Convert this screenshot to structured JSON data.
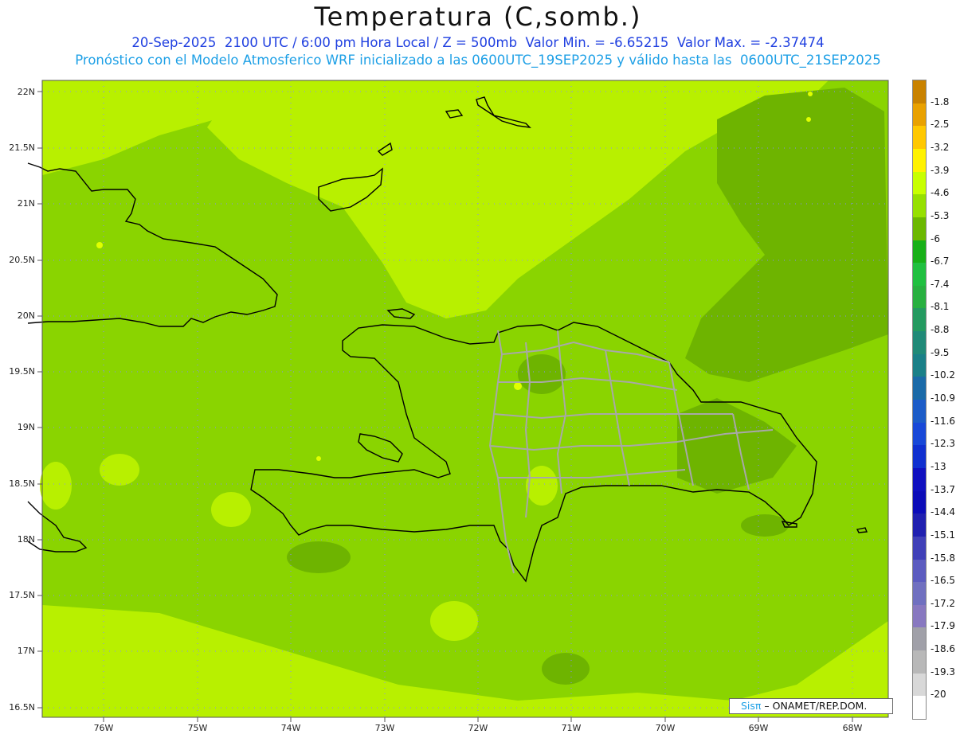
{
  "header": {
    "title": "Temperatura (C,somb.)",
    "subtitle_1": "20-Sep-2025  2100 UTC / 6:00 pm Hora Local / Z = 500mb  Valor Min. = -6.65215  Valor Max. = -2.37474",
    "subtitle_2": "Pronóstico con el Modelo Atmosferico WRF inicializado a las 0600UTC_19SEP2025 y válido hasta las  0600UTC_21SEP2025"
  },
  "axes": {
    "lat_labels": [
      "22N",
      "21.5N",
      "21N",
      "20.5N",
      "20N",
      "19.5N",
      "19N",
      "18.5N",
      "18N",
      "17.5N",
      "17N",
      "16.5N"
    ],
    "lon_labels": [
      "76W",
      "75W",
      "74W",
      "73W",
      "72W",
      "71W",
      "70W",
      "69W",
      "68W"
    ]
  },
  "legend": {
    "labels": [
      "-1.8",
      "-2.5",
      "-3.2",
      "-3.9",
      "-4.6",
      "-5.3",
      "-6",
      "-6.7",
      "-7.4",
      "-8.1",
      "-8.8",
      "-9.5",
      "-10.2",
      "-10.9",
      "-11.6",
      "-12.3",
      "-13",
      "-13.7",
      "-14.4",
      "-15.1",
      "-15.8",
      "-16.5",
      "-17.2",
      "-17.9",
      "-18.6",
      "-19.3",
      "-20"
    ],
    "colors": [
      "#c98200",
      "#e9a100",
      "#ffc800",
      "#fff200",
      "#c8ff00",
      "#96e000",
      "#6cb800",
      "#18b018",
      "#20c040",
      "#28b040",
      "#249a60",
      "#208a78",
      "#1a8088",
      "#1a6aa8",
      "#1c5cc8",
      "#1848d8",
      "#1030d0",
      "#1010c0",
      "#0c0cb8",
      "#2020b0",
      "#4040b8",
      "#5c5cc0",
      "#7070c0",
      "#8878c0",
      "#a0a0a8",
      "#b8b8b8",
      "#d8d8d8",
      "#ffffff"
    ]
  },
  "field_colors": {
    "base": "#8ad400",
    "light": "#b8f000",
    "dark": "#6eb400",
    "warm": "#e0ff00",
    "coast": "#000000",
    "border": "#a8a8a8",
    "grid": "#8888ff"
  },
  "credit": {
    "sis": "Sisπ",
    "org": " – ONAMET/REP.DOM."
  }
}
